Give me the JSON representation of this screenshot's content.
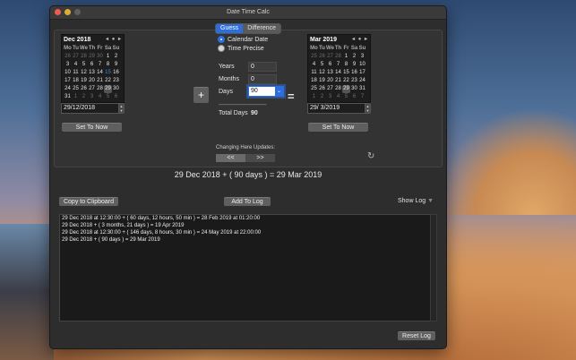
{
  "window": {
    "title": "Date Time Calc"
  },
  "tabs": [
    {
      "label": "Guess",
      "active": true
    },
    {
      "label": "Difference",
      "active": false
    }
  ],
  "left_calendar": {
    "month_label": "Dec 2018",
    "nav": "◂ ● ▸",
    "weekdays": [
      "Mo",
      "Tu",
      "We",
      "Th",
      "Fr",
      "Sa",
      "Su"
    ],
    "days": [
      {
        "d": "26",
        "dim": true
      },
      {
        "d": "27",
        "dim": true
      },
      {
        "d": "28",
        "dim": true
      },
      {
        "d": "29",
        "dim": true
      },
      {
        "d": "30",
        "dim": true
      },
      {
        "d": "1"
      },
      {
        "d": "2"
      },
      {
        "d": "3"
      },
      {
        "d": "4"
      },
      {
        "d": "5"
      },
      {
        "d": "6"
      },
      {
        "d": "7"
      },
      {
        "d": "8"
      },
      {
        "d": "9"
      },
      {
        "d": "10"
      },
      {
        "d": "11"
      },
      {
        "d": "12"
      },
      {
        "d": "13"
      },
      {
        "d": "14"
      },
      {
        "d": "15",
        "today": true
      },
      {
        "d": "16"
      },
      {
        "d": "17"
      },
      {
        "d": "18"
      },
      {
        "d": "19"
      },
      {
        "d": "20"
      },
      {
        "d": "21"
      },
      {
        "d": "22"
      },
      {
        "d": "23"
      },
      {
        "d": "24"
      },
      {
        "d": "25"
      },
      {
        "d": "26"
      },
      {
        "d": "27"
      },
      {
        "d": "28"
      },
      {
        "d": "29",
        "sel": true
      },
      {
        "d": "30"
      },
      {
        "d": "31"
      },
      {
        "d": "1",
        "dim": true
      },
      {
        "d": "2",
        "dim": true
      },
      {
        "d": "3",
        "dim": true
      },
      {
        "d": "4",
        "dim": true
      },
      {
        "d": "5",
        "dim": true
      },
      {
        "d": "6",
        "dim": true
      }
    ],
    "date_value": "29/12/2018",
    "set_now": "Set To Now"
  },
  "right_calendar": {
    "month_label": "Mar 2019",
    "nav": "◂ ● ▸",
    "weekdays": [
      "Mo",
      "Tu",
      "We",
      "Th",
      "Fr",
      "Sa",
      "Su"
    ],
    "days": [
      {
        "d": "25",
        "dim": true
      },
      {
        "d": "26",
        "dim": true
      },
      {
        "d": "27",
        "dim": true
      },
      {
        "d": "28",
        "dim": true
      },
      {
        "d": "1"
      },
      {
        "d": "2"
      },
      {
        "d": "3"
      },
      {
        "d": "4"
      },
      {
        "d": "5"
      },
      {
        "d": "6"
      },
      {
        "d": "7"
      },
      {
        "d": "8"
      },
      {
        "d": "9"
      },
      {
        "d": "10"
      },
      {
        "d": "11"
      },
      {
        "d": "12"
      },
      {
        "d": "13"
      },
      {
        "d": "14"
      },
      {
        "d": "15"
      },
      {
        "d": "16"
      },
      {
        "d": "17"
      },
      {
        "d": "18"
      },
      {
        "d": "19"
      },
      {
        "d": "20"
      },
      {
        "d": "21"
      },
      {
        "d": "22"
      },
      {
        "d": "23"
      },
      {
        "d": "24"
      },
      {
        "d": "25"
      },
      {
        "d": "26"
      },
      {
        "d": "27"
      },
      {
        "d": "28"
      },
      {
        "d": "29",
        "sel": true
      },
      {
        "d": "30"
      },
      {
        "d": "31"
      },
      {
        "d": "1",
        "dim": true
      },
      {
        "d": "2",
        "dim": true
      },
      {
        "d": "3",
        "dim": true
      },
      {
        "d": "4",
        "dim": true
      },
      {
        "d": "5",
        "dim": true
      },
      {
        "d": "6",
        "dim": true
      },
      {
        "d": "7",
        "dim": true
      }
    ],
    "date_value": "29/  3/2019",
    "set_now": "Set To Now"
  },
  "operator": "+",
  "equals": "=",
  "mode": {
    "calendar": "Calendar Date",
    "time": "Time Precise"
  },
  "inputs": {
    "years_label": "Years",
    "years_value": "0",
    "months_label": "Months",
    "months_value": "0",
    "days_label": "Days",
    "days_value": "90",
    "dashes": "-----------------------------",
    "total_label": "Total Days",
    "total_value": "90"
  },
  "changing": {
    "label": "Changing Here Updates:",
    "left": "<<",
    "right": ">>"
  },
  "result": "29 Dec 2018 + ( 90 days ) = 29 Mar 2019",
  "actions": {
    "copy": "Copy to Clipboard",
    "add": "Add To Log",
    "show_log": "Show Log",
    "reset": "Reset Log"
  },
  "log": [
    "29 Dec 2018 at 12:30:00 + ( 60 days, 12 hours, 50 min ) = 28 Feb 2019 at 01:20:00",
    "29 Dec 2018 + ( 3 months, 21 days ) = 19 Apr 2019",
    "29 Dec 2018 at 12:30:00 + ( 146 days, 8 hours, 30 min ) = 24 May 2019 at 22:00:00",
    "29 Dec 2018 + ( 90 days ) = 29 Mar 2019"
  ],
  "colors": {
    "accent": "#2d6ede",
    "window_bg": "#2d2d2d"
  }
}
